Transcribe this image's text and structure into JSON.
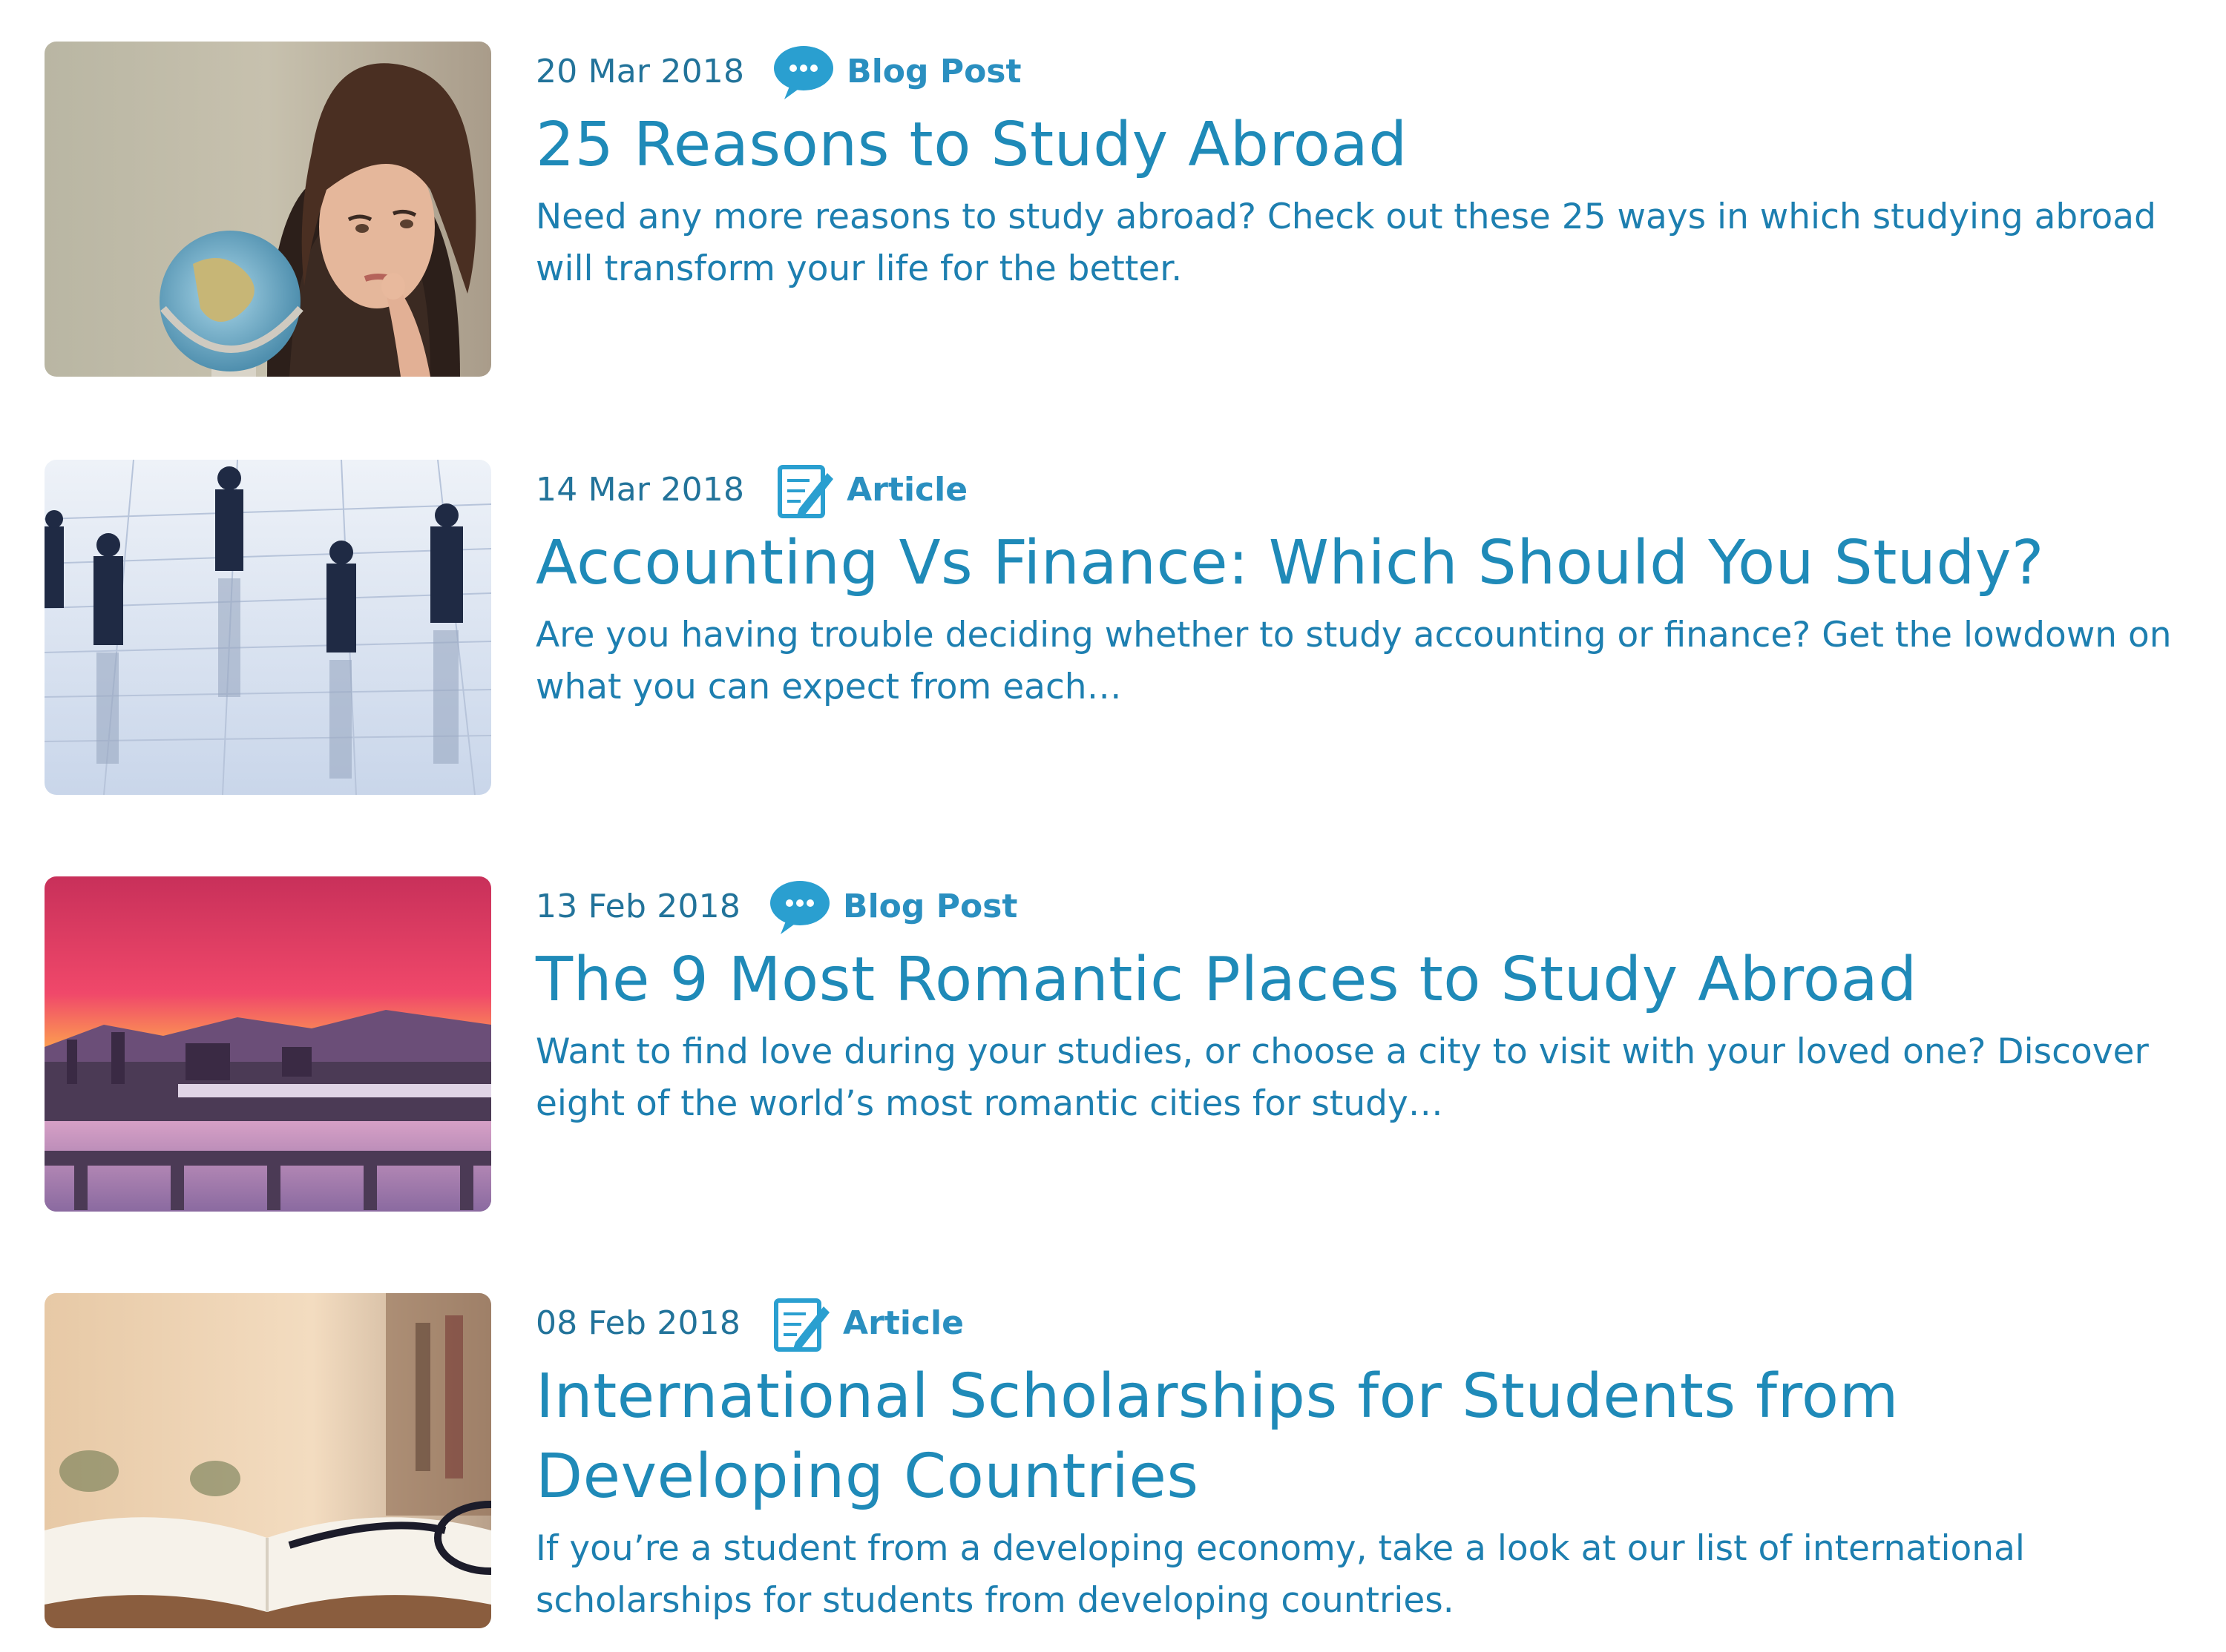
{
  "articles": [
    {
      "date": "20 Mar 2018",
      "type": "Blog Post",
      "type_icon": "speech-bubble-icon",
      "title": "25 Reasons to Study Abroad",
      "description": "Need any more reasons to study abroad? Check out these 25 ways in which studying abroad will transform your life for the better.",
      "image": "woman-with-globe"
    },
    {
      "date": "14 Mar 2018",
      "type": "Article",
      "type_icon": "notepad-pencil-icon",
      "title": "Accounting Vs Finance: Which Should You Study?",
      "description": "Are you having trouble deciding whether to study accounting or finance? Get the lowdown on what you can expect from each…",
      "image": "business-people-on-spreadsheet"
    },
    {
      "date": "13 Feb 2018",
      "type": "Blog Post",
      "type_icon": "speech-bubble-icon",
      "title": "The 9 Most Romantic Places to Study Abroad",
      "description": "Want to find love during your studies, or choose a city to visit with your loved one? Discover eight of the world’s most romantic cities for study…",
      "image": "city-bridges-at-sunset"
    },
    {
      "date": "08 Feb 2018",
      "type": "Article",
      "type_icon": "notepad-pencil-icon",
      "title": "International Scholarships for Students from Developing Countries",
      "description": "If you’re a student from a developing economy, take a look at our list of international scholarships for students from developing countries.",
      "image": "open-book-with-glasses"
    }
  ],
  "colors": {
    "accent": "#1f8ab8",
    "date": "#22739a",
    "icon": "#2a9fd0"
  }
}
